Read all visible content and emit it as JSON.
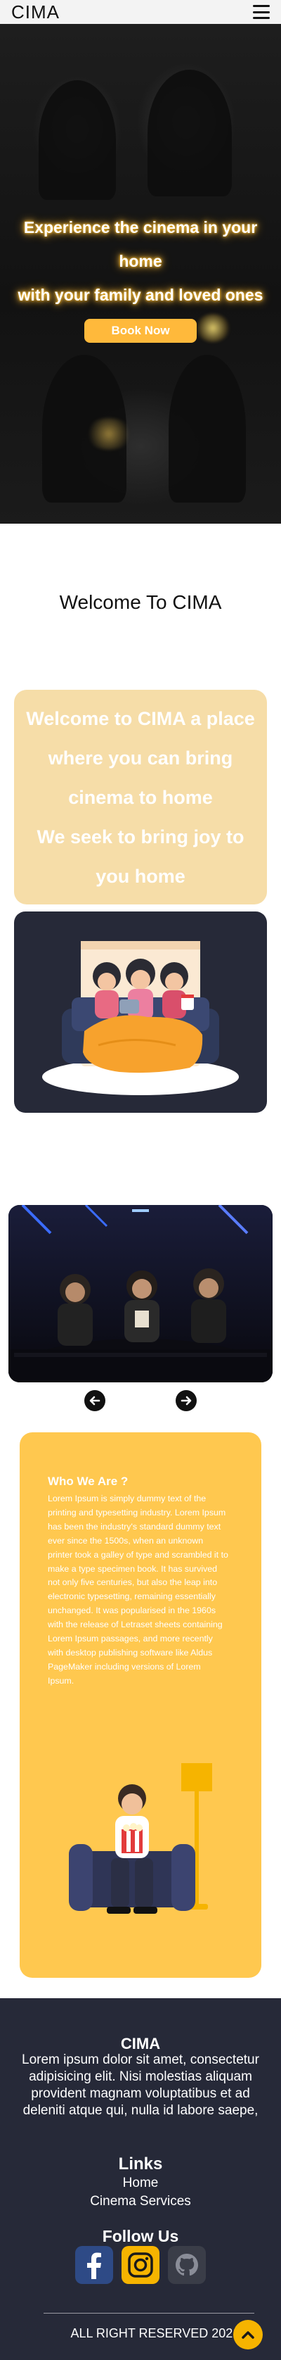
{
  "navbar": {
    "brand": "CIMA",
    "menu_icon": "hamburger-menu-icon"
  },
  "hero": {
    "title_line1": "Experience the cinema in your home",
    "title_line2": "with your family and loved ones",
    "cta_label": "Book Now"
  },
  "welcome": {
    "title": "Welcome To CIMA",
    "card_line1": "Welcome to CIMA a place where you can bring cinema to home",
    "card_line2": "We seek to bring joy to you home"
  },
  "carousel": {
    "prev_icon": "arrow-left-icon",
    "next_icon": "arrow-right-icon"
  },
  "about": {
    "heading": "Who We Are ?",
    "body": "Lorem Ipsum is simply dummy text of the printing and typesetting industry. Lorem Ipsum has been the industry's standard dummy text ever since the 1500s, when an unknown printer took a galley of type and scrambled it to make a type specimen book. It has survived not only five centuries, but also the leap into electronic typesetting, remaining essentially unchanged. It was popularised in the 1960s with the release of Letraset sheets containing Lorem Ipsum passages, and more recently with desktop publishing software like Aldus PageMaker including versions of Lorem Ipsum."
  },
  "footer": {
    "brand": "CIMA",
    "description": "Lorem ipsum dolor sit amet, consectetur adipisicing elit. Nisi molestias aliquam provident magnam voluptatibus et ad deleniti atque qui, nulla id labore saepe,",
    "links_title": "Links",
    "links": [
      "Home",
      "Cinema Services"
    ],
    "follow_title": "Follow Us",
    "socials": [
      "facebook-icon",
      "instagram-icon",
      "github-icon"
    ],
    "copyright": "ALL RIGHT RESERVED 2021 ©",
    "to_top_icon": "chevron-up-icon"
  },
  "colors": {
    "accent": "#ffb93b",
    "about_bg": "#ffc84f",
    "welcome_card_bg": "#f6dda8",
    "dark_bg": "#262938"
  }
}
